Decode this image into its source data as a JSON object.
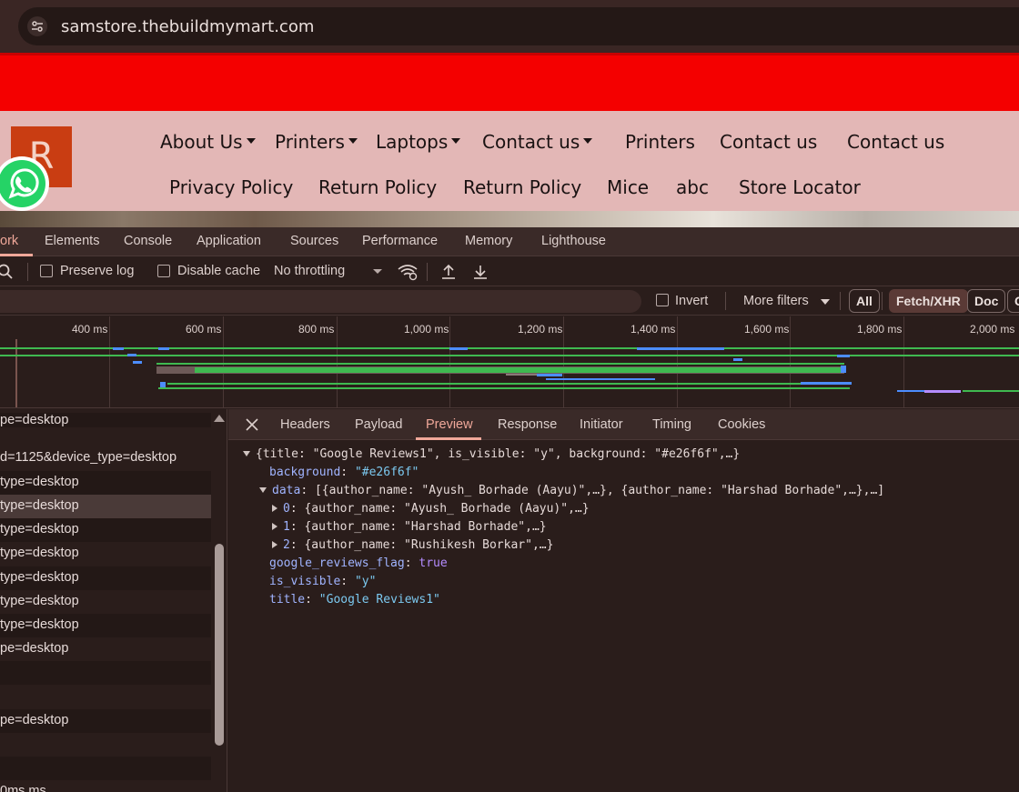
{
  "browser": {
    "url": "samstore.thebuildmymart.com"
  },
  "site": {
    "logo_text": "R",
    "nav_row1": [
      {
        "label": "About Us",
        "has_caret": true
      },
      {
        "label": "Printers",
        "has_caret": true
      },
      {
        "label": "Laptops",
        "has_caret": true
      },
      {
        "label": "Contact us",
        "has_caret": true
      },
      {
        "label": "Printers",
        "has_caret": false
      },
      {
        "label": "Contact us",
        "has_caret": false
      },
      {
        "label": "Contact us",
        "has_caret": false
      }
    ],
    "nav_row2": [
      "Privacy Policy",
      "Return Policy",
      "Return Policy",
      "Mice",
      "abc",
      "Store Locator"
    ],
    "colors": {
      "banner": "#f40000",
      "nav_bg": "#e3b7b6",
      "logo_bg": "#c93d12"
    }
  },
  "devtools": {
    "tabs": [
      "ork",
      "Elements",
      "Console",
      "Application",
      "Sources",
      "Performance",
      "Memory",
      "Lighthouse"
    ],
    "active_tab": "ork",
    "toolbar": {
      "preserve_log": "Preserve log",
      "disable_cache": "Disable cache",
      "throttling": "No throttling"
    },
    "filter": {
      "invert": "Invert",
      "more_filters": "More filters",
      "chips": [
        "All",
        "Fetch/XHR",
        "Doc",
        "C"
      ],
      "selected_chip": "Fetch/XHR"
    },
    "timeline_ticks": [
      "400 ms",
      "600 ms",
      "800 ms",
      "1,000 ms",
      "1,200 ms",
      "1,400 ms",
      "1,600 ms",
      "1,800 ms",
      "2,000 ms"
    ],
    "requests": [
      "pe=desktop",
      "d=1125&device_type=desktop",
      "type=desktop",
      "type=desktop",
      "type=desktop",
      "type=desktop",
      "type=desktop",
      "type=desktop",
      "type=desktop",
      "pe=desktop",
      "",
      "",
      "pe=desktop",
      "",
      "",
      "0ms ms"
    ],
    "selected_request_index": 3,
    "detail_tabs": [
      "Headers",
      "Payload",
      "Preview",
      "Response",
      "Initiator",
      "Timing",
      "Cookies"
    ],
    "active_detail_tab": "Preview",
    "preview": {
      "root": "{title: \"Google Reviews1\", is_visible: \"y\", background: \"#e26f6f\",…}",
      "background_key": "background",
      "background_val": "\"#e26f6f\"",
      "data_key": "data",
      "data_summary": "[{author_name: \"Ayush_ Borhade (Aayu)\",…}, {author_name: \"Harshad Borhade\",…},…]",
      "items": [
        {
          "idx": "0",
          "summary": "{author_name: \"Ayush_ Borhade (Aayu)\",…}"
        },
        {
          "idx": "1",
          "summary": "{author_name: \"Harshad Borhade\",…}"
        },
        {
          "idx": "2",
          "summary": "{author_name: \"Rushikesh Borkar\",…}"
        }
      ],
      "flag_key": "google_reviews_flag",
      "flag_val": "true",
      "visible_key": "is_visible",
      "visible_val": "\"y\"",
      "title_key": "title",
      "title_val": "\"Google Reviews1\""
    }
  }
}
